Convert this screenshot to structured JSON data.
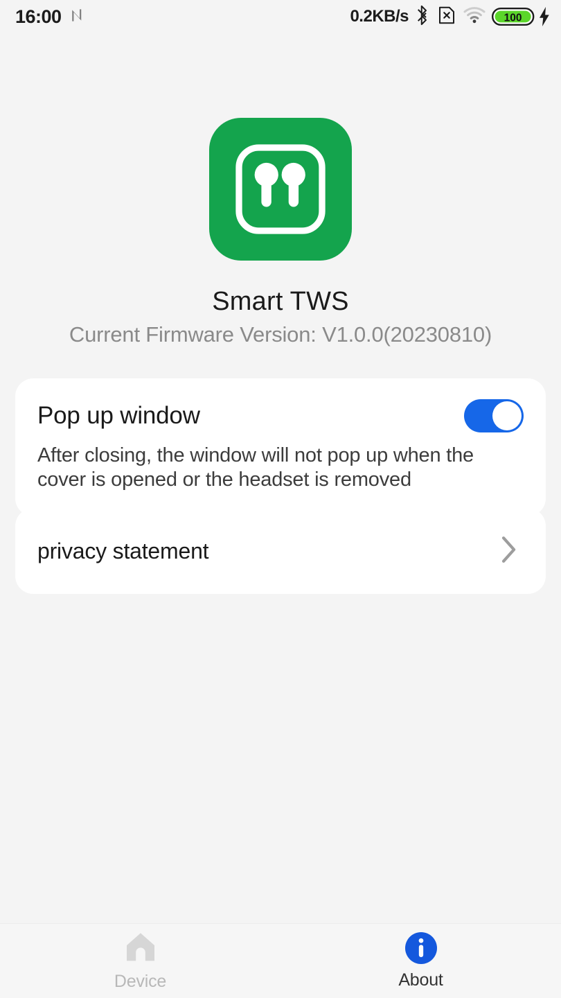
{
  "status_bar": {
    "time": "16:00",
    "nfc_icon": "nfc-icon",
    "network_speed": "0.2KB/s",
    "bluetooth_icon": "bluetooth-icon",
    "sim_icon": "no-sim-icon",
    "wifi_icon": "wifi-icon",
    "battery_level": "100",
    "charging_icon": "charging-bolt-icon",
    "battery_color": "#5bd62a"
  },
  "header": {
    "app_icon_name": "earbuds-app-icon",
    "app_icon_color": "#14a44d",
    "title": "Smart TWS",
    "version": "Current Firmware Version: V1.0.0(20230810)"
  },
  "cards": {
    "popup": {
      "title": "Pop up window",
      "description": "After closing, the window will not pop up when the cover is opened or the headset is removed",
      "toggle_state": "on",
      "toggle_color": "#1667e8"
    },
    "privacy": {
      "label": "privacy statement",
      "chevron_icon": "chevron-right-icon"
    }
  },
  "bottom_nav": {
    "items": [
      {
        "label": "Device",
        "icon": "home-icon",
        "active": false
      },
      {
        "label": "About",
        "icon": "info-circle-icon",
        "active": true
      }
    ],
    "active_color": "#1458dd"
  }
}
